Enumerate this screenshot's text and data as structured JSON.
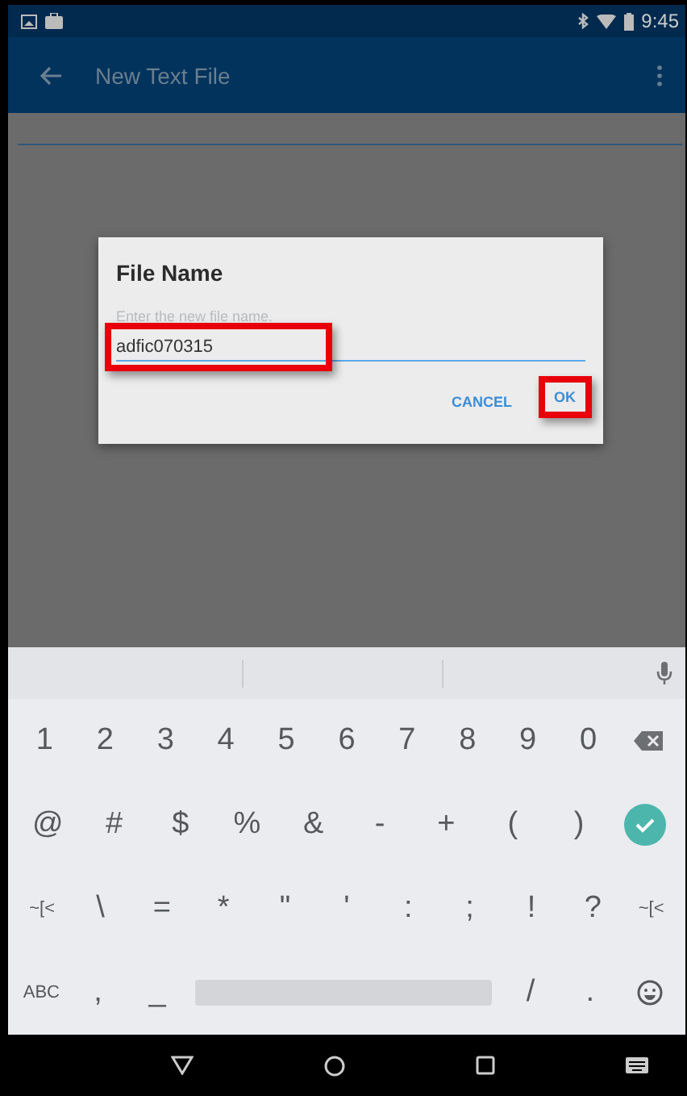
{
  "status_bar": {
    "time": "9:45"
  },
  "app_bar": {
    "title": "New Text File"
  },
  "dialog": {
    "title": "File Name",
    "field": {
      "placeholder": "Enter the new file name.",
      "value": "adfic070315",
      "highlighted": true
    },
    "buttons": [
      {
        "label": "CANCEL",
        "highlighted": false
      },
      {
        "label": "OK",
        "highlighted": true
      }
    ]
  },
  "keyboard": {
    "number_keys": [
      {
        "kind": "char",
        "label": "1"
      },
      {
        "kind": "char",
        "label": "2"
      },
      {
        "kind": "char",
        "label": "3"
      },
      {
        "kind": "char",
        "label": "4"
      },
      {
        "kind": "char",
        "label": "5"
      },
      {
        "kind": "char",
        "label": "6"
      },
      {
        "kind": "char",
        "label": "7"
      },
      {
        "kind": "char",
        "label": "8"
      },
      {
        "kind": "char",
        "label": "9"
      },
      {
        "kind": "char",
        "label": "0"
      },
      {
        "kind": "backspace"
      }
    ],
    "symbol_keys": [
      {
        "kind": "char",
        "label": "@"
      },
      {
        "kind": "char",
        "label": "#"
      },
      {
        "kind": "char",
        "label": "$"
      },
      {
        "kind": "char",
        "label": "%"
      },
      {
        "kind": "char",
        "label": "&"
      },
      {
        "kind": "char",
        "label": "-"
      },
      {
        "kind": "char",
        "label": "+"
      },
      {
        "kind": "char",
        "label": "("
      },
      {
        "kind": "char",
        "label": ")"
      },
      {
        "kind": "done"
      }
    ],
    "punctuation_keys": [
      {
        "kind": "small",
        "label": "~[<"
      },
      {
        "kind": "char",
        "label": "\\"
      },
      {
        "kind": "char",
        "label": "="
      },
      {
        "kind": "char",
        "label": "*"
      },
      {
        "kind": "char",
        "label": "\""
      },
      {
        "kind": "char",
        "label": "'"
      },
      {
        "kind": "char",
        "label": ":"
      },
      {
        "kind": "char",
        "label": ";"
      },
      {
        "kind": "char",
        "label": "!"
      },
      {
        "kind": "char",
        "label": "?"
      },
      {
        "kind": "small",
        "label": "~[<"
      }
    ],
    "bottom_keys": [
      {
        "kind": "small",
        "label": "ABC"
      },
      {
        "kind": "char",
        "label": ","
      },
      {
        "kind": "char",
        "label": "_"
      },
      {
        "kind": "space"
      },
      {
        "kind": "char",
        "label": "/"
      },
      {
        "kind": "char",
        "label": "."
      },
      {
        "kind": "emoji"
      }
    ]
  }
}
